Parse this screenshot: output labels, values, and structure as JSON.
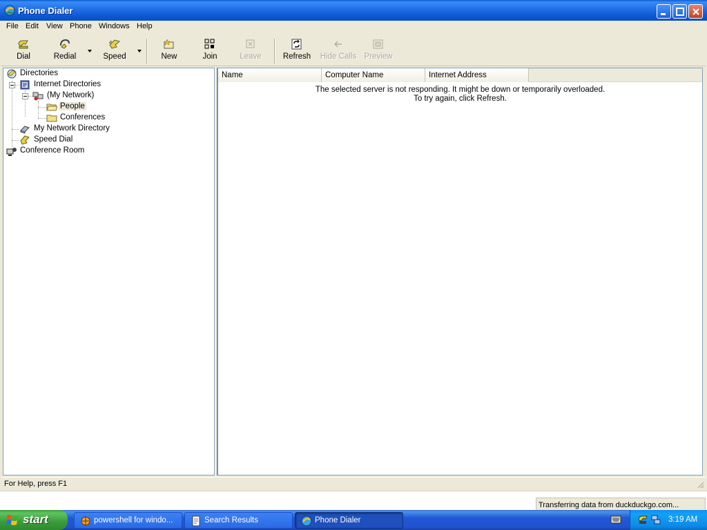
{
  "window": {
    "title": "Phone Dialer"
  },
  "menu": [
    "File",
    "Edit",
    "View",
    "Phone",
    "Windows",
    "Help"
  ],
  "toolbar": [
    {
      "label": "Dial",
      "icon": "dial-icon",
      "enabled": true
    },
    {
      "label": "Redial",
      "icon": "redial-icon",
      "enabled": true
    },
    {
      "label": "Speed",
      "icon": "speed-dial-icon",
      "enabled": true
    },
    {
      "label": "New",
      "icon": "new-conference-icon",
      "enabled": true
    },
    {
      "label": "Join",
      "icon": "join-icon",
      "enabled": true
    },
    {
      "label": "Leave",
      "icon": "leave-icon",
      "enabled": false
    },
    {
      "label": "Refresh",
      "icon": "refresh-icon",
      "enabled": true
    },
    {
      "label": "Hide Calls",
      "icon": "hide-calls-icon",
      "enabled": false
    },
    {
      "label": "Preview",
      "icon": "preview-icon",
      "enabled": false
    }
  ],
  "tree": [
    {
      "label": "Directories",
      "icon": "directories-icon"
    },
    {
      "label": "Internet Directories",
      "icon": "internet-directories-icon"
    },
    {
      "label": "(My Network)",
      "icon": "network-icon"
    },
    {
      "label": "People",
      "icon": "folder-open-icon",
      "selected": true
    },
    {
      "label": "Conferences",
      "icon": "folder-icon"
    },
    {
      "label": "My Network Directory",
      "icon": "network-directory-icon"
    },
    {
      "label": "Speed Dial",
      "icon": "speed-dial-icon"
    },
    {
      "label": "Conference Room",
      "icon": "conference-room-icon"
    }
  ],
  "list": {
    "columns": [
      "Name",
      "Computer Name",
      "Internet Address"
    ],
    "message_line1": "The selected server is not responding. It might be down or temporarily overloaded.",
    "message_line2": "To try again, click Refresh."
  },
  "status": {
    "text": "For Help, press F1"
  },
  "background_status": {
    "text": "Transferring data from duckduckgo.com..."
  },
  "taskbar": {
    "start_label": "start",
    "tasks": [
      {
        "label": "powershell for windo...",
        "icon": "browser-icon",
        "active": false
      },
      {
        "label": "Search Results",
        "icon": "document-icon",
        "active": false
      },
      {
        "label": "Phone Dialer",
        "icon": "phone-dialer-icon",
        "active": true
      }
    ],
    "clock": "3:19 AM"
  }
}
